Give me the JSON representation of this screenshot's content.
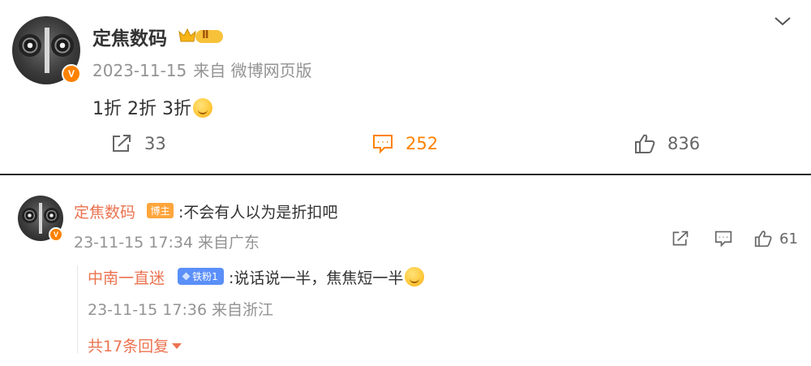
{
  "post": {
    "author": "定焦数码",
    "level_badge": "Ⅱ",
    "date": "2023-11-15",
    "source": "来自 微博网页版",
    "content": "1折 2折 3折",
    "content_emoji": "yum-emoji",
    "verified_badge": "V",
    "actions": {
      "forward_count": "33",
      "comment_count": "252",
      "like_count": "836"
    }
  },
  "comment": {
    "author": "定焦数码",
    "author_badge": "博主",
    "content": ":不会有人以为是折扣吧",
    "time": "23-11-15 17:34",
    "location": "来自广东",
    "like_count": "61",
    "reply": {
      "author": "中南一直迷",
      "fan_badge": "铁粉1",
      "content": ":说话说一半，焦焦短一半",
      "content_emoji": "smile-emoji",
      "time": "23-11-15 17:36",
      "location": "来自浙江"
    },
    "more_replies": "共17条回复"
  },
  "colors": {
    "accent": "#ff8200",
    "username": "#eb7350",
    "meta": "#939393",
    "divider": "#2b2b2b"
  }
}
